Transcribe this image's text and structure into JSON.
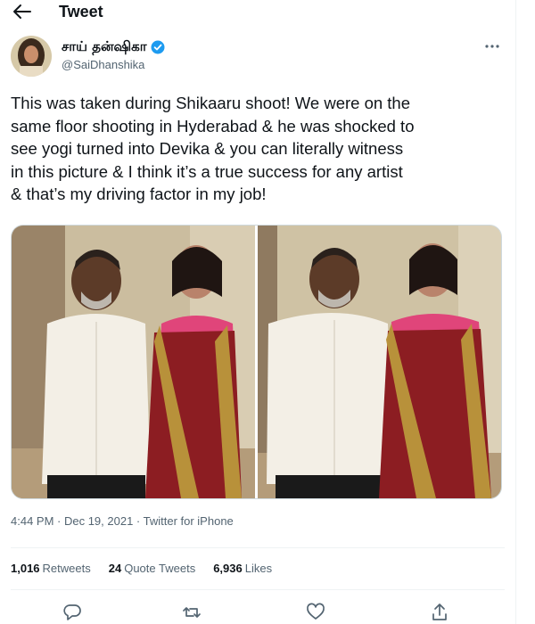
{
  "header": {
    "title": "Tweet"
  },
  "author": {
    "name": "சாய் தன்ஷிகா",
    "handle": "@SaiDhanshika"
  },
  "tweet": {
    "lines": [
      "This was taken during Shikaaru shoot! We were on the",
      "same floor shooting in Hyderabad & he was shocked to",
      "see yogi turned into Devika & you can literally witness",
      "in this picture & I think it’s a true success for any artist",
      "& that’s my driving factor in my job!"
    ]
  },
  "meta": {
    "timestamp": "4:44 PM · Dec 19, 2021 · Twitter for iPhone"
  },
  "stats": {
    "retweets": {
      "value": "1,016",
      "label": "Retweets"
    },
    "quotes": {
      "value": "24",
      "label": "Quote Tweets"
    },
    "likes": {
      "value": "6,936",
      "label": "Likes"
    }
  },
  "icons": {
    "back": "arrow-left-icon",
    "verified": "verified-badge-icon",
    "more": "more-options-icon",
    "reply": "reply-icon",
    "retweet": "retweet-icon",
    "like": "like-icon",
    "share": "share-icon"
  },
  "colors": {
    "verified": "#1d9bf0",
    "text_secondary": "#536471",
    "saree_red": "#8c1d22",
    "saree_gold": "#b8913a",
    "blouse_pink": "#e0457a"
  }
}
